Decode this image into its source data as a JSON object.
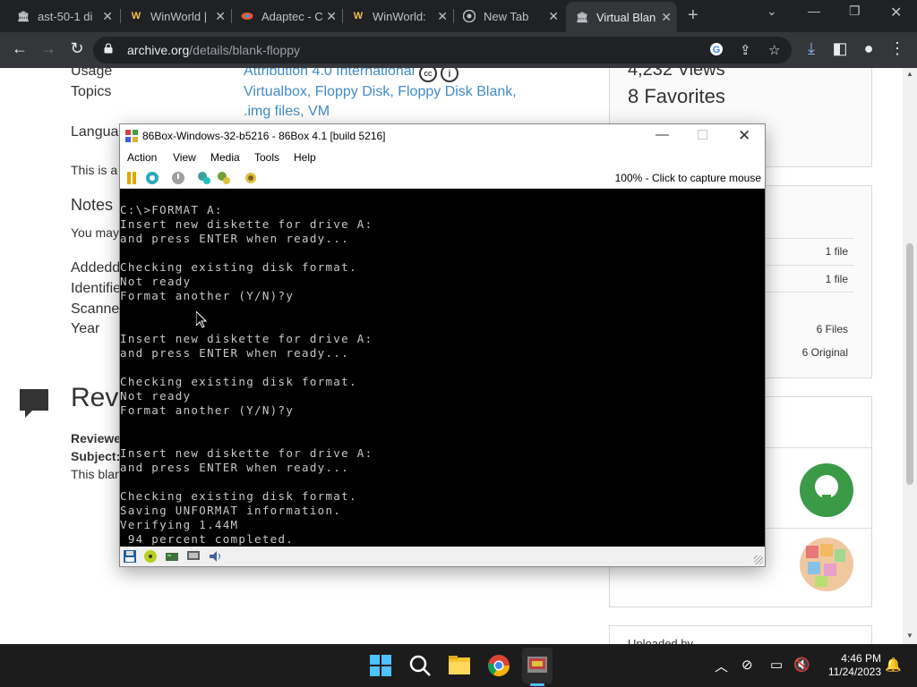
{
  "browser": {
    "tabs": [
      {
        "title": "ast-50-1 di",
        "icon": "archive-icon"
      },
      {
        "title": "WinWorld |",
        "icon": "winworld-icon"
      },
      {
        "title": "Adaptec - C",
        "icon": "adaptec-icon"
      },
      {
        "title": "WinWorld:",
        "icon": "winworld-icon"
      },
      {
        "title": "New Tab",
        "icon": "chrome-icon"
      },
      {
        "title": "Virtual Blan",
        "icon": "archive-icon",
        "active": true
      }
    ],
    "url_host": "archive.org",
    "url_path": "/details/blank-floppy"
  },
  "page": {
    "rows": [
      {
        "label": "Usage",
        "value": "Attribution 4.0 International"
      },
      {
        "label": "Topics",
        "value": "Virtualbox, Floppy Disk, Floppy Disk Blank,"
      },
      {
        "label": "",
        "value": ".img files, VM"
      },
      {
        "label": "Langua",
        "value": ""
      },
      {
        "label": "This is a",
        "value": ""
      },
      {
        "label": "Notes",
        "value": ""
      },
      {
        "label": "You may",
        "value": ""
      },
      {
        "label": "Addedd",
        "value": ""
      },
      {
        "label": "Identifie",
        "value": ""
      },
      {
        "label": "Scanne",
        "value": ""
      },
      {
        "label": "Year",
        "value": ""
      }
    ],
    "reviews_heading": "Revi",
    "reviewer_label": "Reviewe",
    "subject_label": "Subject:",
    "review_body": "This blan",
    "views": "4,232 Views",
    "favorites": "8 Favorites",
    "files": [
      "1 file",
      "1 file",
      "6 Files",
      "6 Original"
    ],
    "uploaded_by": "Uploaded by"
  },
  "vm": {
    "title": "86Box-Windows-32-b5216 - 86Box 4.1 [build 5216]",
    "menu": [
      "Action",
      "View",
      "Media",
      "Tools",
      "Help"
    ],
    "status": "100% - Click to capture mouse",
    "screen_text": "C:\\>FORMAT A:\nInsert new diskette for drive A:\nand press ENTER when ready...\n\nChecking existing disk format.\nNot ready\nFormat another (Y/N)?y\n\n\nInsert new diskette for drive A:\nand press ENTER when ready...\n\nChecking existing disk format.\nNot ready\nFormat another (Y/N)?y\n\n\nInsert new diskette for drive A:\nand press ENTER when ready...\n\nChecking existing disk format.\nSaving UNFORMAT information.\nVerifying 1.44M\n 94 percent completed.",
    "format_progress_percent": 94
  },
  "taskbar": {
    "time": "4:46 PM",
    "date": "11/24/2023"
  },
  "colors": {
    "link": "#428bca",
    "chrome_dark": "#202124",
    "dos_text": "#c8c8c8",
    "taskbar": "#1c1c1c"
  }
}
